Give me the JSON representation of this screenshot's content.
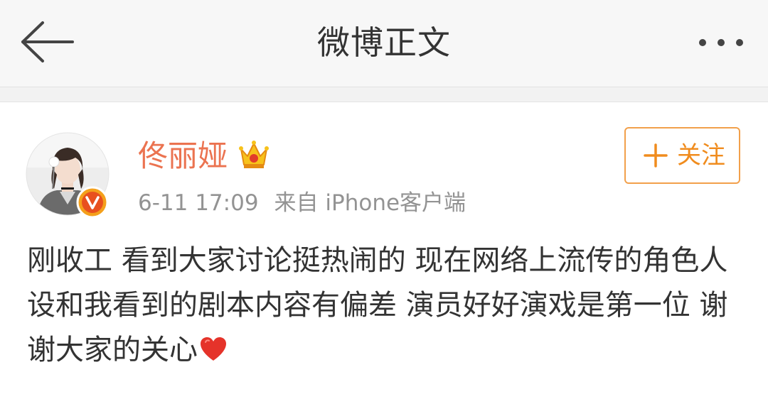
{
  "nav": {
    "title": "微博正文",
    "back_icon": "arrow-left-icon",
    "more_icon": "more-dots-icon"
  },
  "post": {
    "author": {
      "name": "佟丽娅",
      "avatar_icon": "avatar",
      "verified_icon": "verified-v-icon",
      "member_icon": "crown-icon"
    },
    "time": "6-11 17:09",
    "source": "来自 iPhone客户端",
    "follow_button": {
      "label": "关注",
      "icon": "plus-icon"
    },
    "text": "刚收工 看到大家讨论挺热闹的 现在网络上流传的角色人设和我看到的剧本内容有偏差 演员好好演戏是第一位 谢谢大家的关心",
    "emoji_icon": "heart-icon"
  },
  "colors": {
    "accent": "#eb7350",
    "follow": "#f08c1e",
    "text": "#333333",
    "meta": "#939393",
    "header_bg": "#f7f7f7",
    "heart": "#e5332a"
  }
}
